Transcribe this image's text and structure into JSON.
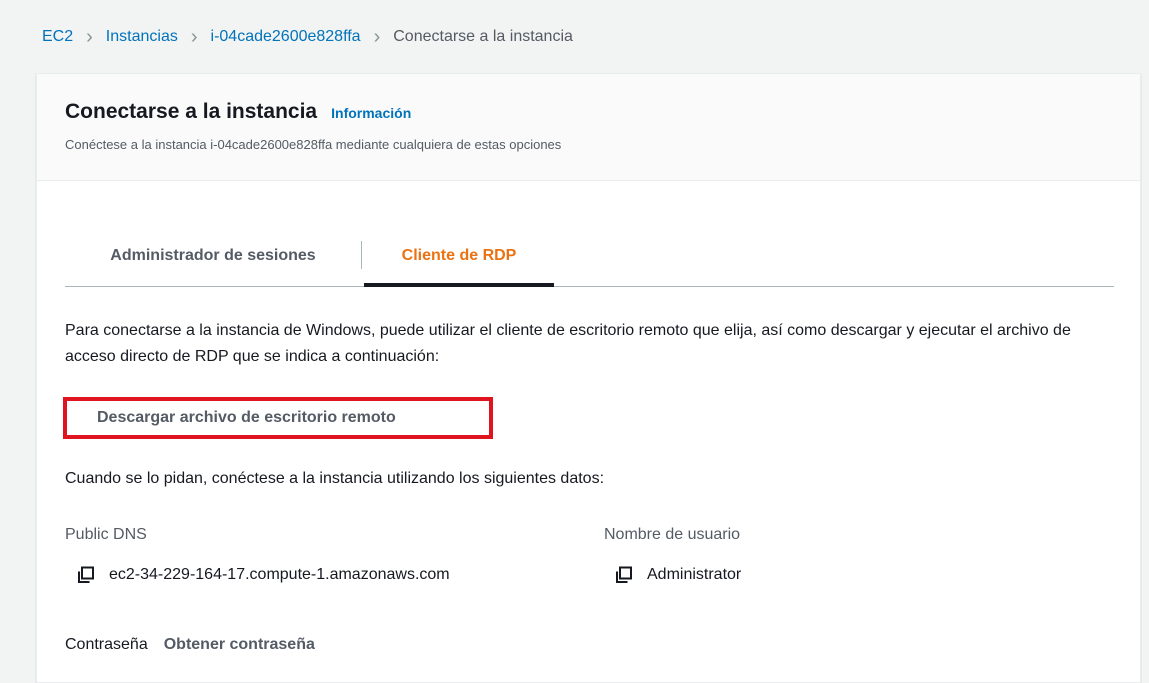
{
  "breadcrumb": {
    "items": [
      {
        "label": "EC2"
      },
      {
        "label": "Instancias"
      },
      {
        "label": "i-04cade2600e828ffa"
      }
    ],
    "current": "Conectarse a la instancia",
    "separator": "›"
  },
  "header": {
    "title": "Conectarse a la instancia",
    "info_link": "Información",
    "subtitle": "Conéctese a la instancia i-04cade2600e828ffa mediante cualquiera de estas opciones"
  },
  "tabs": [
    {
      "label": "Administrador de sesiones",
      "active": false
    },
    {
      "label": "Cliente de RDP",
      "active": true
    }
  ],
  "rdp": {
    "description": "Para conectarse a la instancia de Windows, puede utilizar el cliente de escritorio remoto que elija, así como descargar y ejecutar el archivo de acceso directo de RDP que se indica a continuación:",
    "download_label": "Descargar archivo de escritorio remoto",
    "prompt": "Cuando se lo pidan, conéctese a la instancia utilizando los siguientes datos:",
    "public_dns_label": "Public DNS",
    "public_dns_value": "ec2-34-229-164-17.compute-1.amazonaws.com",
    "username_label": "Nombre de usuario",
    "username_value": "Administrator",
    "password_label": "Contraseña",
    "password_button": "Obtener contraseña"
  },
  "colors": {
    "link": "#0073bb",
    "active_tab": "#ec7211",
    "highlight_box": "#e0141e"
  }
}
